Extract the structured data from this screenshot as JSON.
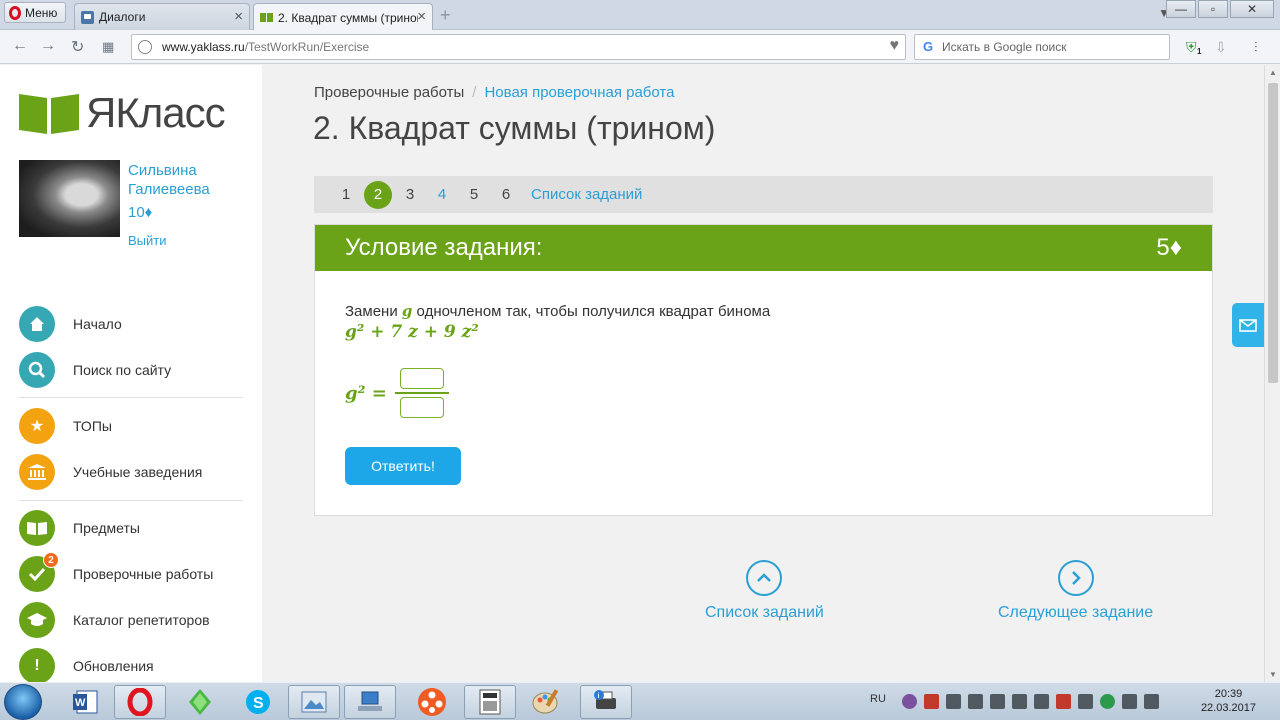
{
  "browser": {
    "menu_label": "Меню",
    "tabs": [
      {
        "label": "Диалоги"
      },
      {
        "label": "2. Квадрат суммы (трином"
      }
    ],
    "url_host": "www.yaklass.ru",
    "url_path": "/TestWorkRun/Exercise",
    "search_placeholder": "Искать в Google поиск",
    "ext_badge": "1"
  },
  "site": {
    "logo_text": "ЯКласс",
    "brand_color": "#6aa318"
  },
  "user": {
    "name": "Сильвина Галиевеева",
    "points": "10♦",
    "logout": "Выйти"
  },
  "sidebar": {
    "items": [
      {
        "label": "Начало",
        "icon": "home-icon"
      },
      {
        "label": "Поиск по сайту",
        "icon": "search-icon"
      },
      {
        "label": "ТОПы",
        "icon": "star-icon"
      },
      {
        "label": "Учебные заведения",
        "icon": "building-icon"
      },
      {
        "label": "Предметы",
        "icon": "book-icon"
      },
      {
        "label": "Проверочные работы",
        "icon": "check-icon",
        "badge": "2"
      },
      {
        "label": "Каталог репетиторов",
        "icon": "graduation-cap-icon"
      },
      {
        "label": "Обновления",
        "icon": "exclamation-icon",
        "glyph": "!"
      }
    ]
  },
  "breadcrumb": {
    "root": "Проверочные работы",
    "separator": "/",
    "current": "Новая проверочная работа"
  },
  "page_title": "2. Квадрат суммы (трином)",
  "pager": {
    "pages": [
      "1",
      "2",
      "3",
      "4",
      "5",
      "6"
    ],
    "current": "2",
    "list_label": "Список заданий"
  },
  "task": {
    "heading": "Условие задания:",
    "points": "5♦",
    "text_before": "Замени ",
    "var": "g",
    "text_after": " одночленом так, чтобы получился квадрат бинома",
    "formula": "g² + 7 z + 9 z²",
    "lhs": "g² =",
    "answer_button": "Ответить!"
  },
  "bottom_nav": {
    "list_label": "Список заданий",
    "next_label": "Следующее задание"
  },
  "taskbar": {
    "lang": "RU",
    "time": "20:39",
    "date": "22.03.2017"
  }
}
